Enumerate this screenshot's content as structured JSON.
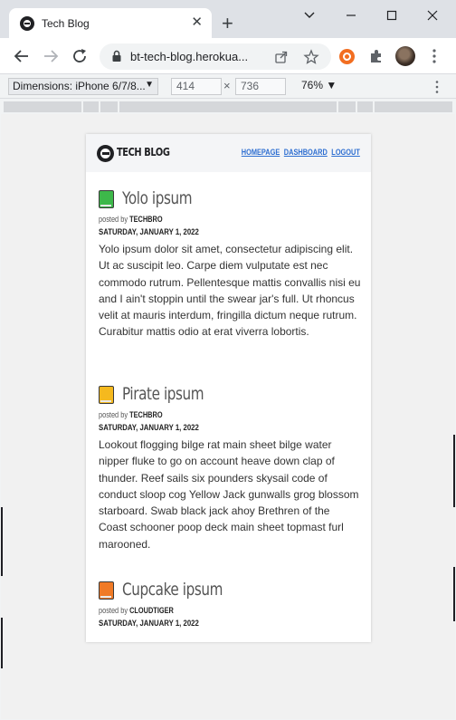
{
  "browser": {
    "tab_title": "Tech Blog",
    "url": "bt-tech-blog.herokua...",
    "colors": {
      "tab_strip": "#dee1e6",
      "toolbar": "#ffffff",
      "ext_orange": "#f26e21"
    }
  },
  "devtools": {
    "device": "Dimensions: iPhone 6/7/8...",
    "width": "414",
    "height": "736",
    "times": "×",
    "zoom": "76%"
  },
  "site": {
    "title": "TECH BLOG",
    "nav": {
      "homepage": "HOMEPAGE",
      "dashboard": "DASHBOARD",
      "logout": "LOGOUT"
    },
    "link_color": "#2e6fd1",
    "posts": [
      {
        "title": "Yolo ipsum",
        "posted_by_prefix": "posted by",
        "author": "TECHBRO",
        "date": "SATURDAY, JANUARY 1, 2022",
        "icon": "green-book-icon",
        "icon_color": "#3db84a",
        "body": "Yolo ipsum dolor sit amet, consectetur adipiscing elit. Ut ac suscipit leo. Carpe diem vulputate est nec commodo rutrum. Pellentesque mattis convallis nisi eu and I ain't stoppin until the swear jar's full. Ut rhoncus velit at mauris interdum, fringilla dictum neque rutrum. Curabitur mattis odio at erat viverra lobortis."
      },
      {
        "title": "Pirate ipsum",
        "posted_by_prefix": "posted by",
        "author": "TECHBRO",
        "date": "SATURDAY, JANUARY 1, 2022",
        "icon": "yellow-book-icon",
        "icon_color": "#f5b91e",
        "body": "Lookout flogging bilge rat main sheet bilge water nipper fluke to go on account heave down clap of thunder. Reef sails six pounders skysail code of conduct sloop cog Yellow Jack gunwalls grog blossom starboard. Swab black jack ahoy Brethren of the Coast schooner poop deck main sheet topmast furl marooned."
      },
      {
        "title": "Cupcake ipsum",
        "posted_by_prefix": "posted by",
        "author": "CLOUDTIGER",
        "date": "SATURDAY, JANUARY 1, 2022",
        "icon": "orange-book-icon",
        "icon_color": "#f07a26",
        "body": ""
      }
    ]
  }
}
